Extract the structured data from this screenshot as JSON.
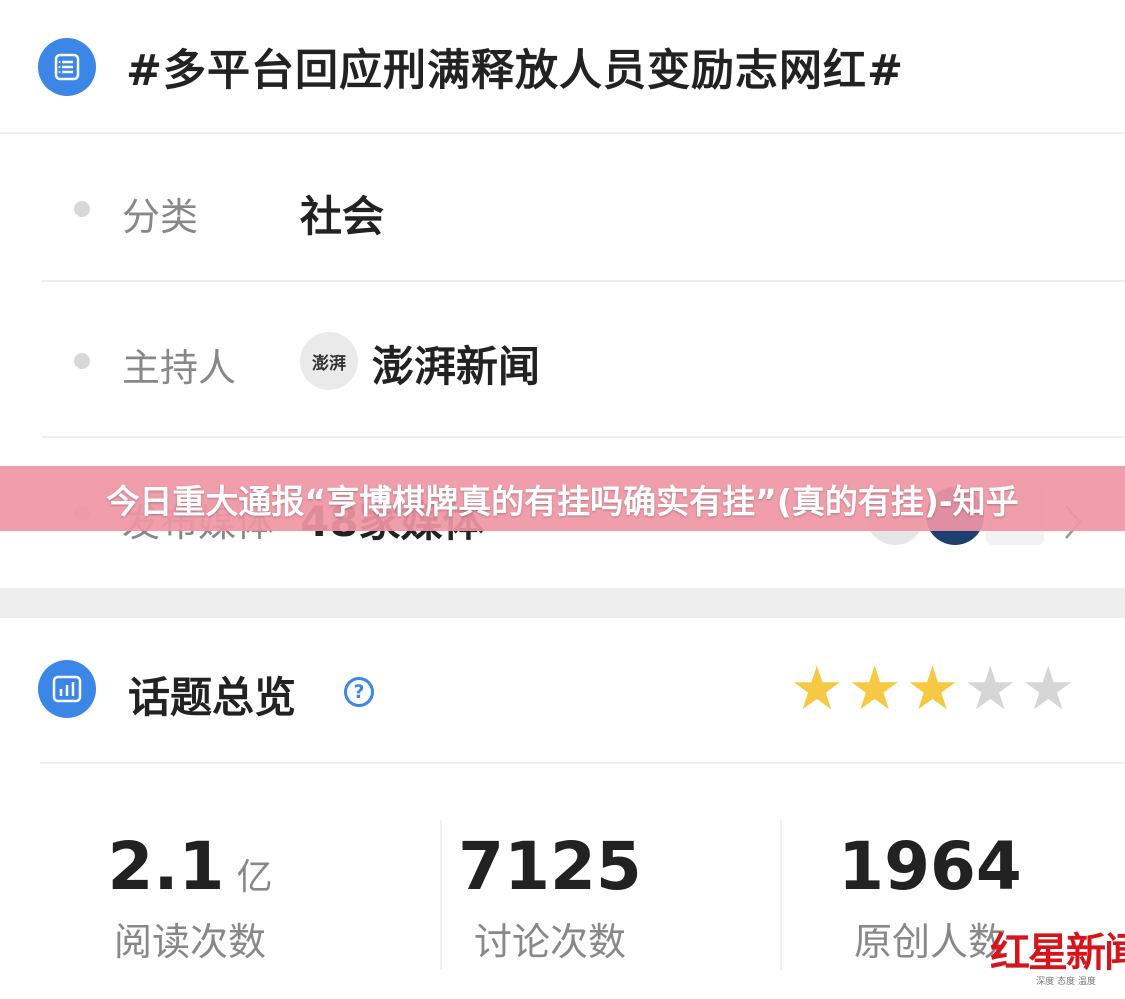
{
  "topic": {
    "title": "#多平台回应刑满释放人员变励志网红#",
    "icon": "list-icon"
  },
  "info_rows": [
    {
      "label": "分类",
      "value": "社会"
    },
    {
      "label": "主持人",
      "value": "澎湃新闻",
      "avatar_text": "澎湃"
    },
    {
      "label": "发布媒体",
      "value": "48家媒体"
    }
  ],
  "banner": {
    "text": "今日重大通报“亨博棋牌真的有挂吗确实有挂”(真的有挂)-知乎"
  },
  "overview": {
    "title": "话题总览",
    "help_icon": "question-circle-icon",
    "chart_icon": "bar-chart-icon",
    "rating_filled": 3,
    "rating_total": 5
  },
  "stats": [
    {
      "number": "2.1",
      "unit": "亿",
      "label": "阅读次数"
    },
    {
      "number": "7125",
      "unit": "",
      "label": "讨论次数"
    },
    {
      "number": "1964",
      "unit": "",
      "label": "原创人数"
    }
  ],
  "watermark": {
    "main": "红星新闻",
    "sub": "深度 态度 温度"
  },
  "colors": {
    "accent": "#3b86e6",
    "banner": "#f096a5",
    "star_filled": "#f6c945",
    "star_empty": "#d6d6d6",
    "brand_red": "#d5141b"
  }
}
